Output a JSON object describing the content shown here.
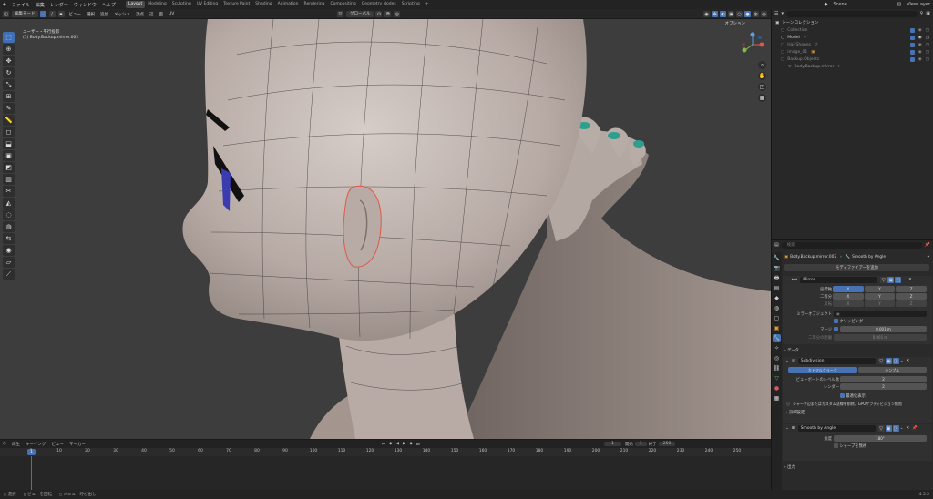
{
  "menubar": {
    "items": [
      "ファイル",
      "編集",
      "レンダー",
      "ウィンドウ",
      "ヘルプ"
    ],
    "workspaces": [
      "Layout",
      "Modeling",
      "Sculpting",
      "UV Editing",
      "Texture Paint",
      "Shading",
      "Animation",
      "Rendering",
      "Compositing",
      "Geometry Nodes",
      "Scripting"
    ],
    "active_workspace": "Layout",
    "scene": "Scene",
    "view_layer": "ViewLayer"
  },
  "viewport_header": {
    "mode": "編集モード",
    "menus": [
      "ビュー",
      "選択",
      "追加",
      "メッシュ",
      "頂点",
      "辺",
      "面",
      "UV"
    ],
    "transform_orientation": "グローバル",
    "options": "オプション"
  },
  "viewport": {
    "view_name": "ユーザー・平行投影",
    "object_name": "(1) Body.Backup.mirror.002"
  },
  "timeline": {
    "menus": [
      "再生",
      "キーイング",
      "ビュー",
      "マーカー"
    ],
    "current_frame": "1",
    "start_label": "開始",
    "start": "1",
    "end_label": "終了",
    "end": "250",
    "ticks": [
      "0",
      "10",
      "20",
      "30",
      "40",
      "50",
      "60",
      "70",
      "80",
      "90",
      "100",
      "110",
      "120",
      "130",
      "140",
      "150",
      "160",
      "170",
      "180",
      "190",
      "200",
      "210",
      "220",
      "230",
      "240",
      "250"
    ]
  },
  "statusbar": {
    "items": [
      "選択",
      "ビューを回転",
      "メニュー呼び出し"
    ],
    "version": "4.3.2"
  },
  "outliner": {
    "search_placeholder": "",
    "root": "シーンコレクション",
    "items": [
      "Collection",
      "Model",
      "HairShapes",
      "image_01",
      "Backup.Objects",
      "Body.Backup.mirror"
    ]
  },
  "properties": {
    "search_placeholder": "検索",
    "object": "Body.Backup.mirror.002",
    "modifier_name": "Smooth by Angle",
    "add_modifier": "モディファイアーを追加",
    "mirror": {
      "name": "Mirror",
      "axis_label": "座標軸",
      "bisect_label": "二等分",
      "flip_label": "反転",
      "x": "X",
      "y": "Y",
      "z": "Z",
      "mirror_object_label": "ミラーオブジェクト",
      "clipping": "クリッピング",
      "merge_label": "マージ",
      "merge_value": "0.001 m",
      "bisect_dist_label": "二等分の距離",
      "bisect_dist_value": "0.001 m",
      "data_label": "データ"
    },
    "subdivision": {
      "name": "Subdivision",
      "tab1": "カトマルクラーク",
      "tab2": "シンプル",
      "viewport_levels_label": "ビューポートのレベル数",
      "viewport_levels": "2",
      "render_label": "レンダー",
      "render": "2",
      "optimal_display": "最適化表示",
      "info": "シャープ辺またはカスタム法線を削除、GPUサブディビジョン無効",
      "advanced": "詳細設定"
    },
    "smooth": {
      "name": "Smooth by Angle",
      "angle_label": "角度",
      "angle": "180°",
      "ignore_sharpness": "シャープを無視",
      "output": "出力"
    }
  },
  "colors": {
    "accent": "#4772b3",
    "selection_outline": "#e0574a",
    "nail": "#2e9e8f"
  }
}
